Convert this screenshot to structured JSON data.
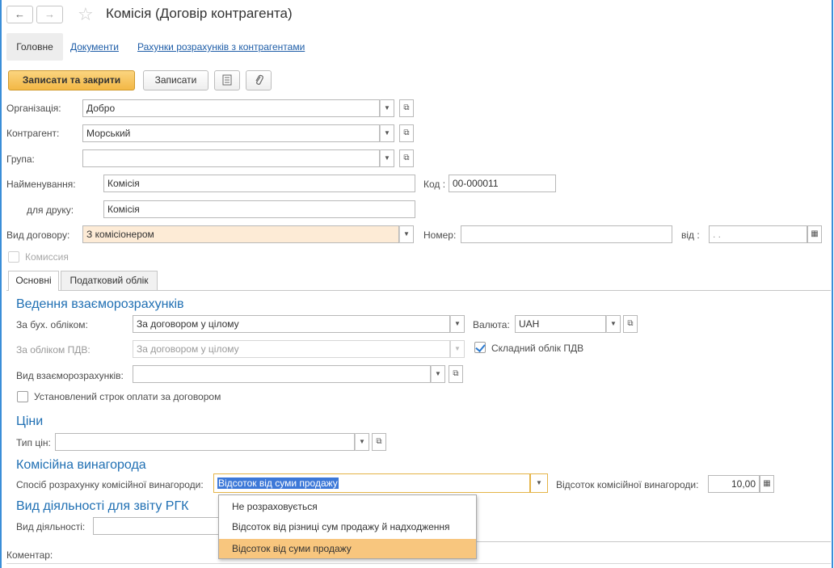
{
  "header": {
    "title": "Комісія (Договір контрагента)",
    "back_icon": "←",
    "forward_icon": "→",
    "star_icon": "☆"
  },
  "nav": {
    "tabs": [
      {
        "label": "Головне"
      },
      {
        "label": "Документи"
      },
      {
        "label": "Рахунки розрахунків з контрагентами"
      }
    ]
  },
  "toolbar": {
    "save_close_label": "Записати та закрити",
    "save_label": "Записати"
  },
  "form": {
    "organization": {
      "label": "Організація:",
      "value": "Добро"
    },
    "counterparty": {
      "label": "Контрагент:",
      "value": "Морський"
    },
    "group": {
      "label": "Група:",
      "value": ""
    },
    "name": {
      "label": "Найменування:",
      "value": "Комісія"
    },
    "code": {
      "label": "Код",
      "value": "00-000011"
    },
    "print_name": {
      "label": "для друку:",
      "value": "Комісія"
    },
    "contract_type": {
      "label": "Вид договору:",
      "value": "З комісіонером"
    },
    "number": {
      "label": "Номер:",
      "value": ""
    },
    "date": {
      "label": "від",
      "value": " .  ."
    },
    "commission_checkbox": {
      "label": "Комиссия",
      "checked": false
    }
  },
  "tabs": [
    {
      "label": "Основні"
    },
    {
      "label": "Податковий облік"
    }
  ],
  "settlements": {
    "title": "Ведення взаєморозрахунків",
    "accounting": {
      "label": "За бух. обліком:",
      "value": "За договором у цілому"
    },
    "vat": {
      "label": "За обліком ПДВ:",
      "value": "За договором у цілому"
    },
    "currency": {
      "label": "Валюта:",
      "value": "UAH"
    },
    "complex_vat": {
      "label": "Складний облік ПДВ",
      "checked": true
    },
    "kind": {
      "label": "Вид взаєморозрахунків:",
      "value": ""
    },
    "payment_term": {
      "label": "Установлений строк оплати за договором",
      "checked": false
    }
  },
  "prices": {
    "title": "Ціни",
    "price_type": {
      "label": "Тип цін:",
      "value": ""
    }
  },
  "commission": {
    "title": "Комісійна винагорода",
    "method": {
      "label": "Спосіб розрахунку комісійної винагороди:",
      "value": "Відсоток від суми продажу"
    },
    "percent": {
      "label": "Відсоток комісійної винагороди:",
      "value": "10,00"
    }
  },
  "activity": {
    "title": "Вид діяльності для звіту РГК",
    "kind": {
      "label": "Вид діяльності:",
      "value": ""
    }
  },
  "comment": {
    "label": "Коментар:"
  },
  "dropdown": {
    "options": [
      {
        "label": "Не розраховується"
      },
      {
        "label": "Відсоток від різниці сум продажу й надходження"
      },
      {
        "label": "Відсоток від суми продажу",
        "selected": true
      }
    ]
  },
  "colors": {
    "accent": "#1f6fb3",
    "link": "#1f5ea8",
    "primary_button": "#f3b845",
    "selected_option": "#f8c67e",
    "frame_border": "#3a8ed8"
  }
}
